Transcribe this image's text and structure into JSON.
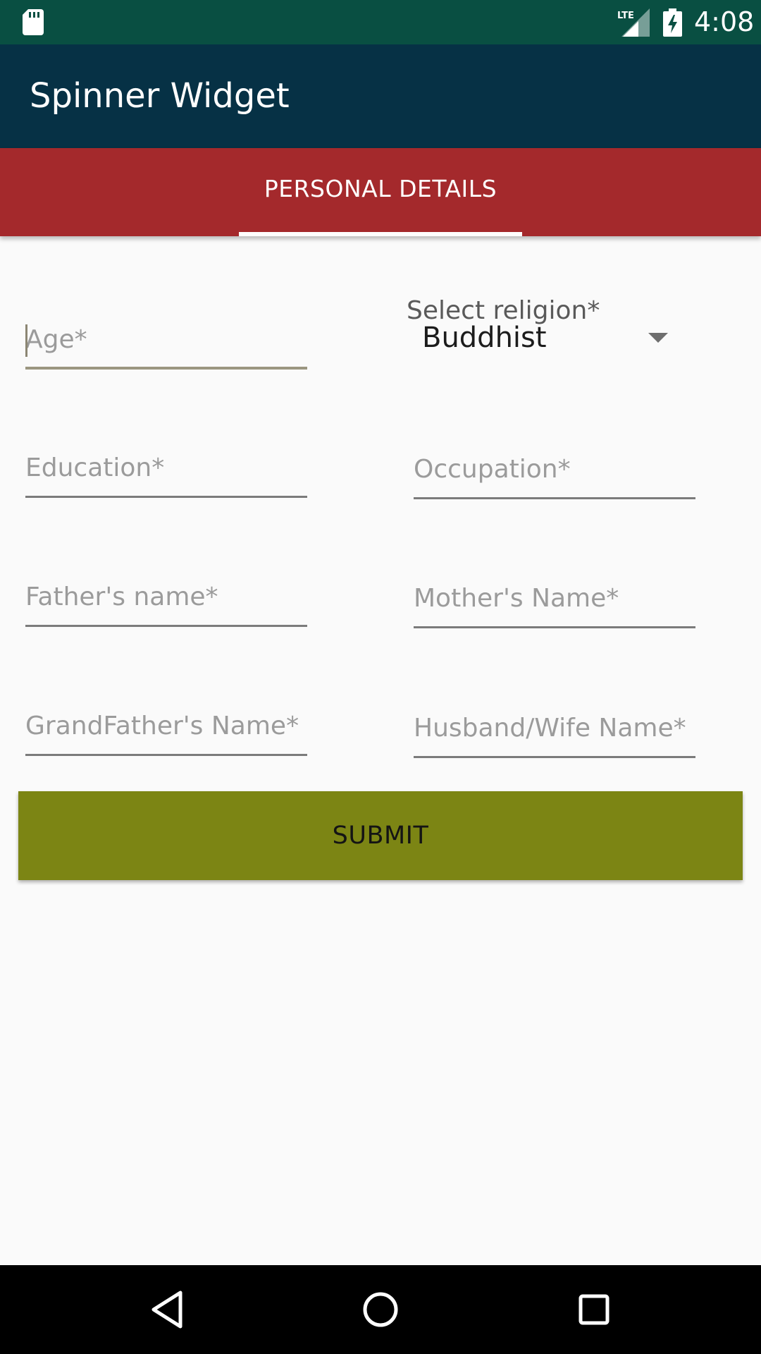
{
  "status_bar": {
    "time": "4:08",
    "network": "LTE"
  },
  "app_bar": {
    "title": "Spinner Widget"
  },
  "tabs": [
    {
      "label": "PERSONAL DETAILS",
      "selected": true
    }
  ],
  "form": {
    "age": {
      "placeholder": "Age*",
      "value": ""
    },
    "religion": {
      "label": "Select religion*",
      "selected": "Buddhist"
    },
    "education": {
      "placeholder": "Education*",
      "value": ""
    },
    "occupation": {
      "placeholder": "Occupation*",
      "value": ""
    },
    "father_name": {
      "placeholder": "Father's name*",
      "value": ""
    },
    "mother_name": {
      "placeholder": "Mother's Name*",
      "value": ""
    },
    "grandfather_name": {
      "placeholder": "GrandFather's Name*",
      "value": ""
    },
    "spouse_name": {
      "placeholder": "Husband/Wife Name*",
      "value": ""
    },
    "submit_label": "SUBMIT"
  },
  "colors": {
    "status_bar": "#094f42",
    "app_bar": "#063145",
    "tab_bar": "#a4292c",
    "submit_button": "#7c8514",
    "background": "#fafafa",
    "nav_bar": "#000000"
  },
  "icons": {
    "status_left": "sd-card-icon",
    "signal": "signal-icon",
    "battery": "battery-charging-icon",
    "nav_back": "back-icon",
    "nav_home": "home-icon",
    "nav_recents": "recents-icon",
    "spinner": "dropdown-caret-icon"
  }
}
